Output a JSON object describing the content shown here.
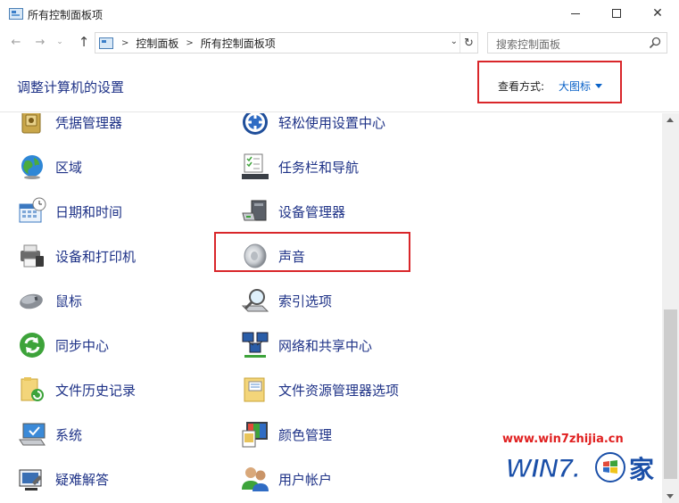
{
  "window": {
    "title": "所有控制面板项"
  },
  "address": {
    "crumbs": [
      "控制面板",
      "所有控制面板项"
    ],
    "search_placeholder": "搜索控制面板"
  },
  "header": {
    "title": "调整计算机的设置",
    "view_by_label": "查看方式:",
    "view_by_value": "大图标"
  },
  "items": {
    "credential_manager": "凭据管理器",
    "region": "区域",
    "date_time": "日期和时间",
    "devices_printers": "设备和打印机",
    "mouse": "鼠标",
    "sync_center": "同步中心",
    "file_history": "文件历史记录",
    "system": "系统",
    "troubleshooting": "疑难解答",
    "ease_of_access": "轻松使用设置中心",
    "taskbar_navigation": "任务栏和导航",
    "device_manager": "设备管理器",
    "sound": "声音",
    "indexing_options": "索引选项",
    "network_sharing": "网络和共享中心",
    "file_explorer_options": "文件资源管理器选项",
    "color_management": "颜色管理",
    "user_accounts": "用户帐户"
  },
  "watermark": {
    "url": "www.win7zhijia.cn",
    "logo_text": "WIN7.",
    "logo_suffix": "家"
  },
  "colors": {
    "link_text": "#1e3287",
    "highlight_border": "#d9262a",
    "view_value": "#0a62c8",
    "watermark_red": "#e02020"
  }
}
